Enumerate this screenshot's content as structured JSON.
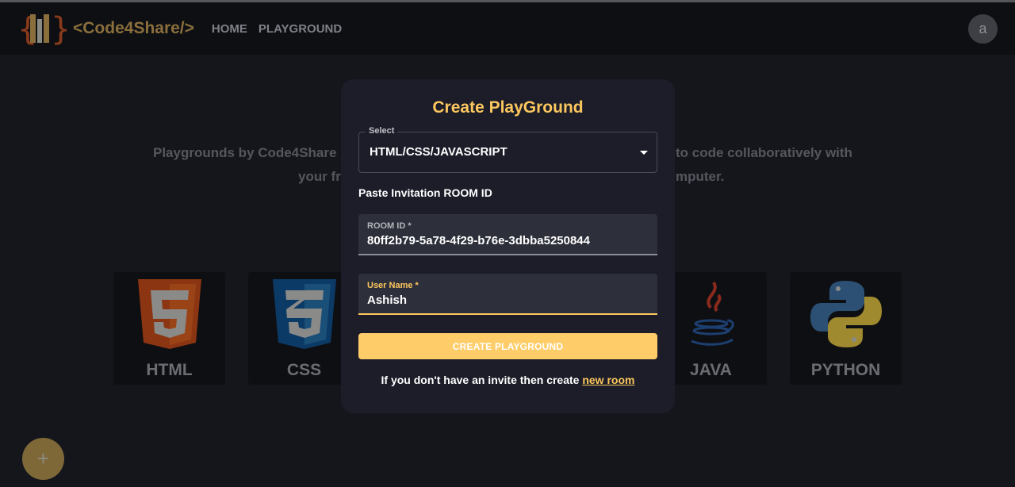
{
  "header": {
    "brand": "<Code4Share/>",
    "nav": [
      "HOME",
      "PLAYGROUND"
    ],
    "avatar": "a"
  },
  "background": {
    "line1_left": "Playgrounds by Code4Share",
    "line1_right": "to code collaboratively with",
    "line2_left": "your fr",
    "line2_right": "mputer."
  },
  "cards": [
    {
      "label": "HTML",
      "icon": "html5-icon"
    },
    {
      "label": "CSS",
      "icon": "css3-icon"
    },
    {
      "label": "JAVA",
      "icon": "java-icon"
    },
    {
      "label": "PYTHON",
      "icon": "python-icon"
    }
  ],
  "fab": {
    "icon": "plus-icon",
    "label": "+"
  },
  "modal": {
    "title": "Create PlayGround",
    "select": {
      "label": "Select",
      "value": "HTML/CSS/JAVASCRIPT"
    },
    "paste_label": "Paste Invitation ROOM ID",
    "room_id": {
      "label": "ROOM ID *",
      "value": "80ff2b79-5a78-4f29-b76e-3dbba5250844"
    },
    "user_name": {
      "label": "User Name *",
      "value": "Ashish"
    },
    "button": "CREATE PLAYGROUND",
    "footer_text": "If you don't have an invite then create ",
    "footer_link": "new room"
  },
  "colors": {
    "accent": "#fcc75e",
    "button": "#fecd6a",
    "modal_bg": "#1c1d29"
  }
}
